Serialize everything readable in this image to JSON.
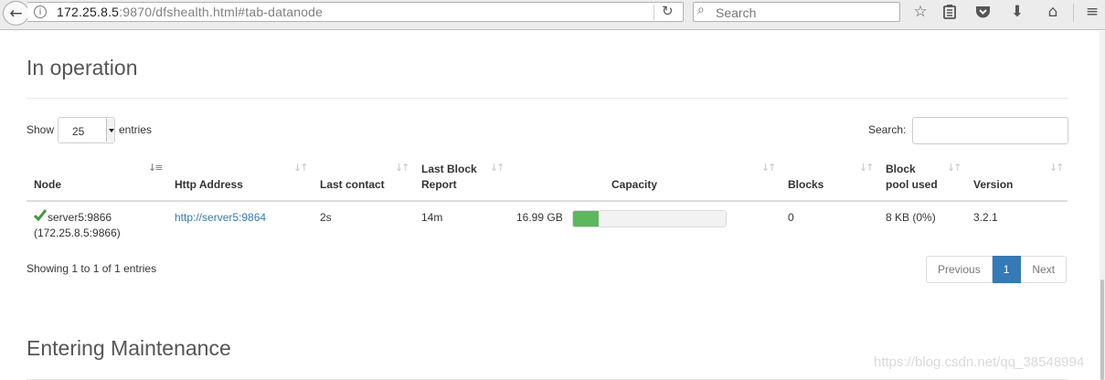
{
  "browser": {
    "url_host": "172.25.8.5",
    "url_rest": ":9870/dfshealth.html#tab-datanode",
    "search_placeholder": "Search",
    "icons": [
      "back-arrow-icon",
      "info-icon",
      "reload-icon",
      "search-icon",
      "bookmark-star-icon",
      "reading-list-icon",
      "pocket-icon",
      "download-icon",
      "home-icon",
      "hamburger-menu-icon"
    ]
  },
  "section_in_operation": {
    "title": "In operation",
    "length_label_prefix": "Show",
    "length_value": "25",
    "length_label_suffix": "entries",
    "search_label": "Search:",
    "columns": [
      {
        "line1": "",
        "line2": "Node"
      },
      {
        "line1": "",
        "line2": "Http Address"
      },
      {
        "line1": "",
        "line2": "Last contact"
      },
      {
        "line1": "Last Block",
        "line2": "Report"
      },
      {
        "line1": "",
        "line2": "Capacity"
      },
      {
        "line1": "",
        "line2": "Blocks"
      },
      {
        "line1": "Block",
        "line2": "pool used"
      },
      {
        "line1": "",
        "line2": "Version"
      }
    ],
    "rows": [
      {
        "node_name": "server5:9866",
        "node_addr": "(172.25.8.5:9866)",
        "http_address": "http://server5:9864",
        "last_contact": "2s",
        "last_block_report": "14m",
        "capacity": "16.99 GB",
        "capacity_used_fraction": 0.17,
        "blocks": "0",
        "block_pool_used": "8 KB (0%)",
        "version": "3.2.1"
      }
    ],
    "info": "Showing 1 to 1 of 1 entries",
    "pagination": {
      "previous": "Previous",
      "current": "1",
      "next": "Next"
    }
  },
  "section_entering_maintenance": {
    "title": "Entering Maintenance"
  },
  "watermark": "https://blog.csdn.net/qq_38548994",
  "colors": {
    "link": "#337ab7",
    "capacity_bar": "#5cb85c",
    "active_page": "#337ab7",
    "check": "#3c9a3c"
  }
}
